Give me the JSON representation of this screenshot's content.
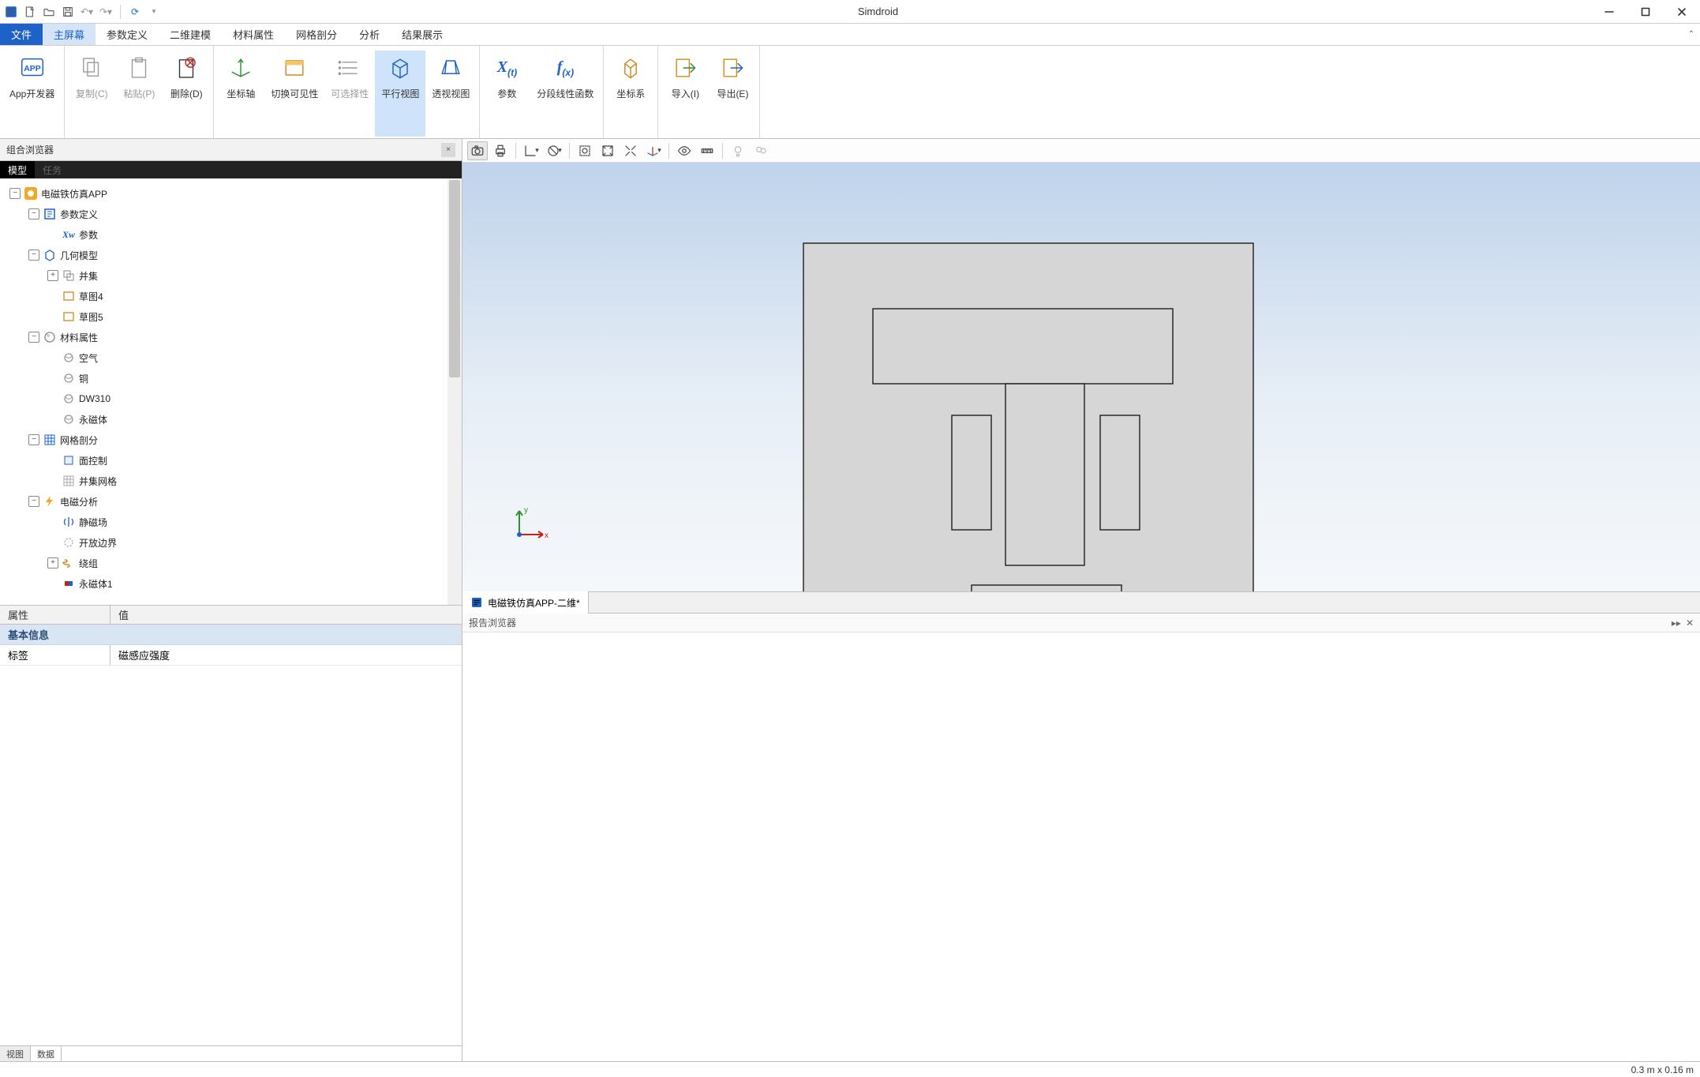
{
  "app": {
    "title": "Simdroid"
  },
  "menu": {
    "file": "文件",
    "tabs": [
      "主屏幕",
      "参数定义",
      "二维建模",
      "材料属性",
      "网格剖分",
      "分析",
      "结果展示"
    ],
    "active": 0
  },
  "ribbon": {
    "app_dev": "App开发器",
    "copy": "复制(C)",
    "paste": "粘贴(P)",
    "delete": "删除(D)",
    "axis": "坐标轴",
    "toggle_vis": "切换可见性",
    "selectable": "可选择性",
    "parallel": "平行视图",
    "persp": "透视视图",
    "params": "参数",
    "piecewise": "分段线性函数",
    "coordsys": "坐标系",
    "import": "导入(I)",
    "export": "导出(E)"
  },
  "left": {
    "dock_title": "组合浏览器",
    "tab_model": "模型",
    "tab_task": "任务",
    "tree": [
      {
        "d": 0,
        "exp": "-",
        "ico": "app",
        "t": "电磁铁仿真APP"
      },
      {
        "d": 1,
        "exp": "-",
        "ico": "params",
        "t": "参数定义"
      },
      {
        "d": 2,
        "exp": "",
        "ico": "xw",
        "t": "参数"
      },
      {
        "d": 1,
        "exp": "-",
        "ico": "geom",
        "t": "几何模型"
      },
      {
        "d": 2,
        "exp": "+",
        "ico": "union",
        "t": "并集"
      },
      {
        "d": 2,
        "exp": "",
        "ico": "sketch",
        "t": "草图4"
      },
      {
        "d": 2,
        "exp": "",
        "ico": "sketch",
        "t": "草图5"
      },
      {
        "d": 1,
        "exp": "-",
        "ico": "mat",
        "t": "材料属性"
      },
      {
        "d": 2,
        "exp": "",
        "ico": "ball",
        "t": "空气"
      },
      {
        "d": 2,
        "exp": "",
        "ico": "ball",
        "t": "铜"
      },
      {
        "d": 2,
        "exp": "",
        "ico": "ball",
        "t": "DW310"
      },
      {
        "d": 2,
        "exp": "",
        "ico": "ball",
        "t": "永磁体"
      },
      {
        "d": 1,
        "exp": "-",
        "ico": "mesh",
        "t": "网格剖分"
      },
      {
        "d": 2,
        "exp": "",
        "ico": "face",
        "t": "面控制"
      },
      {
        "d": 2,
        "exp": "",
        "ico": "meshg",
        "t": "并集网格"
      },
      {
        "d": 1,
        "exp": "-",
        "ico": "bolt",
        "t": "电磁分析"
      },
      {
        "d": 2,
        "exp": "",
        "ico": "field",
        "t": "静磁场"
      },
      {
        "d": 2,
        "exp": "",
        "ico": "open",
        "t": "开放边界"
      },
      {
        "d": 2,
        "exp": "+",
        "ico": "coil",
        "t": "绕组"
      },
      {
        "d": 2,
        "exp": "",
        "ico": "perm",
        "t": "永磁体1"
      }
    ],
    "prop": {
      "col_a": "属性",
      "col_b": "值",
      "section": "基本信息",
      "row_k": "标签",
      "row_v": "磁感应强度"
    },
    "bottom_tabs": [
      "视图",
      "数据"
    ]
  },
  "doc_tab": "电磁铁仿真APP-二维*",
  "report": {
    "title": "报告浏览器"
  },
  "status": {
    "dims": "0.3 m x 0.16 m"
  }
}
